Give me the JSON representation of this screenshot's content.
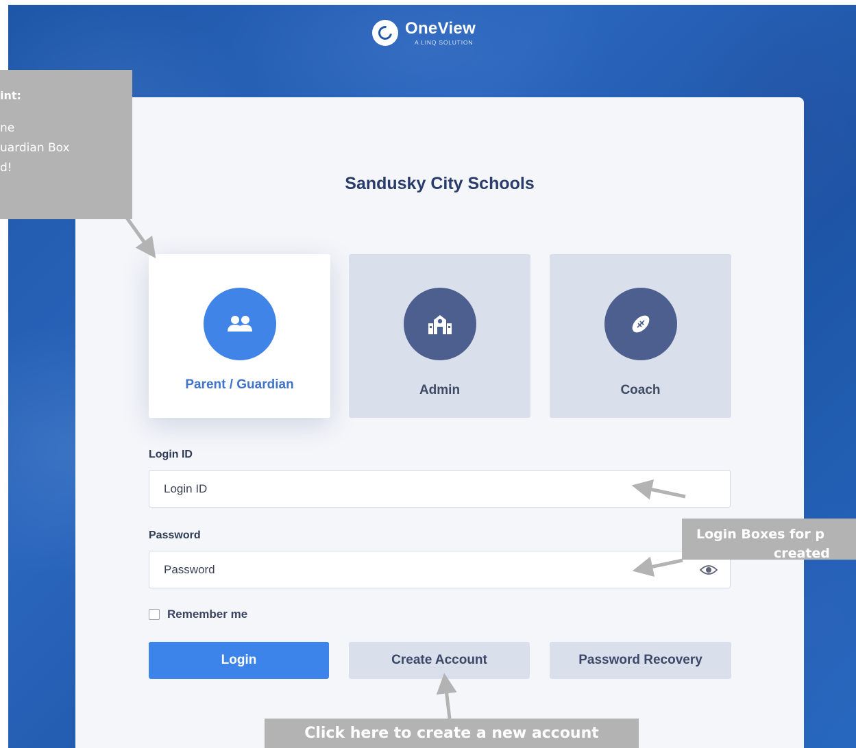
{
  "logo": {
    "name": "OneView",
    "subtitle": "A LINQ SOLUTION"
  },
  "school": {
    "name": "Sandusky City Schools"
  },
  "roles": [
    {
      "label": "Parent / Guardian",
      "icon": "users-icon",
      "selected": true
    },
    {
      "label": "Admin",
      "icon": "school-building-icon",
      "selected": false
    },
    {
      "label": "Coach",
      "icon": "football-icon",
      "selected": false
    }
  ],
  "login": {
    "login_id_label": "Login ID",
    "login_id_placeholder": "Login ID",
    "password_label": "Password",
    "password_placeholder": "Password",
    "show_password_icon": "eye-icon",
    "remember_label": "Remember me",
    "remember_checked": false
  },
  "buttons": {
    "login": "Login",
    "create_account": "Create Account",
    "password_recovery": "Password Recovery"
  },
  "annotations": {
    "hint_title": "int:",
    "hint_lines": [
      "ne",
      "uardian Box",
      "d!"
    ],
    "login_boxes_line1": "Login Boxes for p",
    "login_boxes_line2": "created",
    "create_hint": "Click here to create a new account"
  },
  "colors": {
    "background": "#1f57a8",
    "card": "#f4f6fa",
    "accent": "#3d84ea",
    "role_inactive": "#d9dfeb",
    "role_icon_inactive": "#4c5f8f",
    "school_title": "#2a3c6b",
    "callout": "#b3b3b3"
  }
}
